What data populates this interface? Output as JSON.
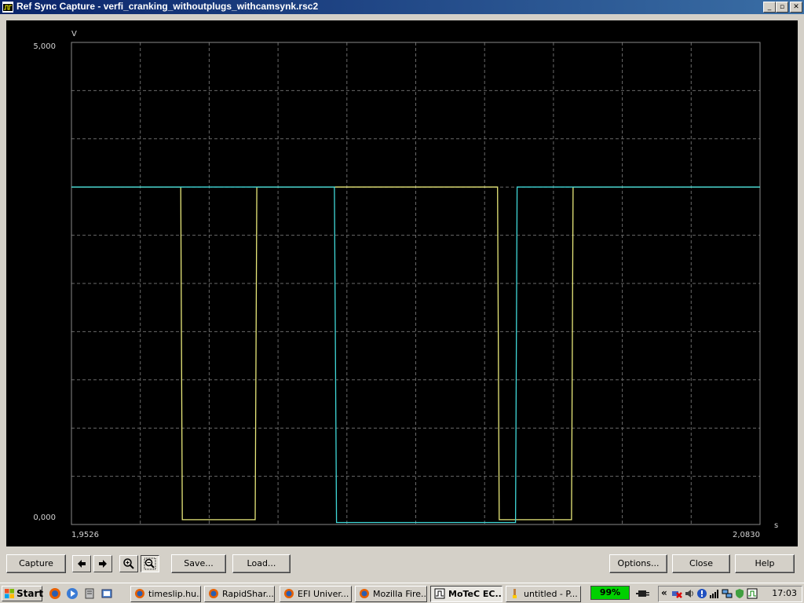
{
  "window": {
    "title": "Ref Sync Capture - verfi_cranking_withoutplugs_withcamsynk.rsc2",
    "controls": {
      "minimize": "_",
      "maximize": "▫",
      "close": "✕"
    }
  },
  "chart_data": {
    "type": "line",
    "title": "",
    "ylabel": "V",
    "xlabel": "s",
    "xlim": [
      1.9526,
      2.083
    ],
    "ylim": [
      0,
      5
    ],
    "x_tick_labels": [
      "1,9526",
      "2,0830"
    ],
    "y_tick_labels": [
      "5,000",
      "0,000"
    ],
    "grid": true,
    "series": [
      {
        "color": "#e8e87a",
        "x": [
          1.9526,
          1.9733,
          1.9736,
          1.9874,
          1.9877,
          2.0333,
          2.0336,
          2.0473,
          2.0476,
          2.083
        ],
        "y": [
          3.5,
          3.5,
          0.05,
          0.05,
          3.5,
          3.5,
          0.05,
          0.05,
          3.5,
          3.5
        ]
      },
      {
        "color": "#40d8d8",
        "x": [
          1.9526,
          2.0024,
          2.0028,
          2.0367,
          2.037,
          2.083
        ],
        "y": [
          3.5,
          3.5,
          0.02,
          0.02,
          3.5,
          3.5
        ]
      }
    ]
  },
  "toolbar": {
    "capture": "Capture",
    "save": "Save...",
    "load": "Load...",
    "options": "Options...",
    "close": "Close",
    "help": "Help"
  },
  "taskbar": {
    "start": "Start",
    "tasks": [
      "timeslip.hu...",
      "RapidShar...",
      "EFI Univer...",
      "Mozilla Fire...",
      "MoTeC EC...",
      "untitled - P..."
    ],
    "battery": "99%",
    "tray_chevron": "«",
    "clock": "17:03"
  }
}
